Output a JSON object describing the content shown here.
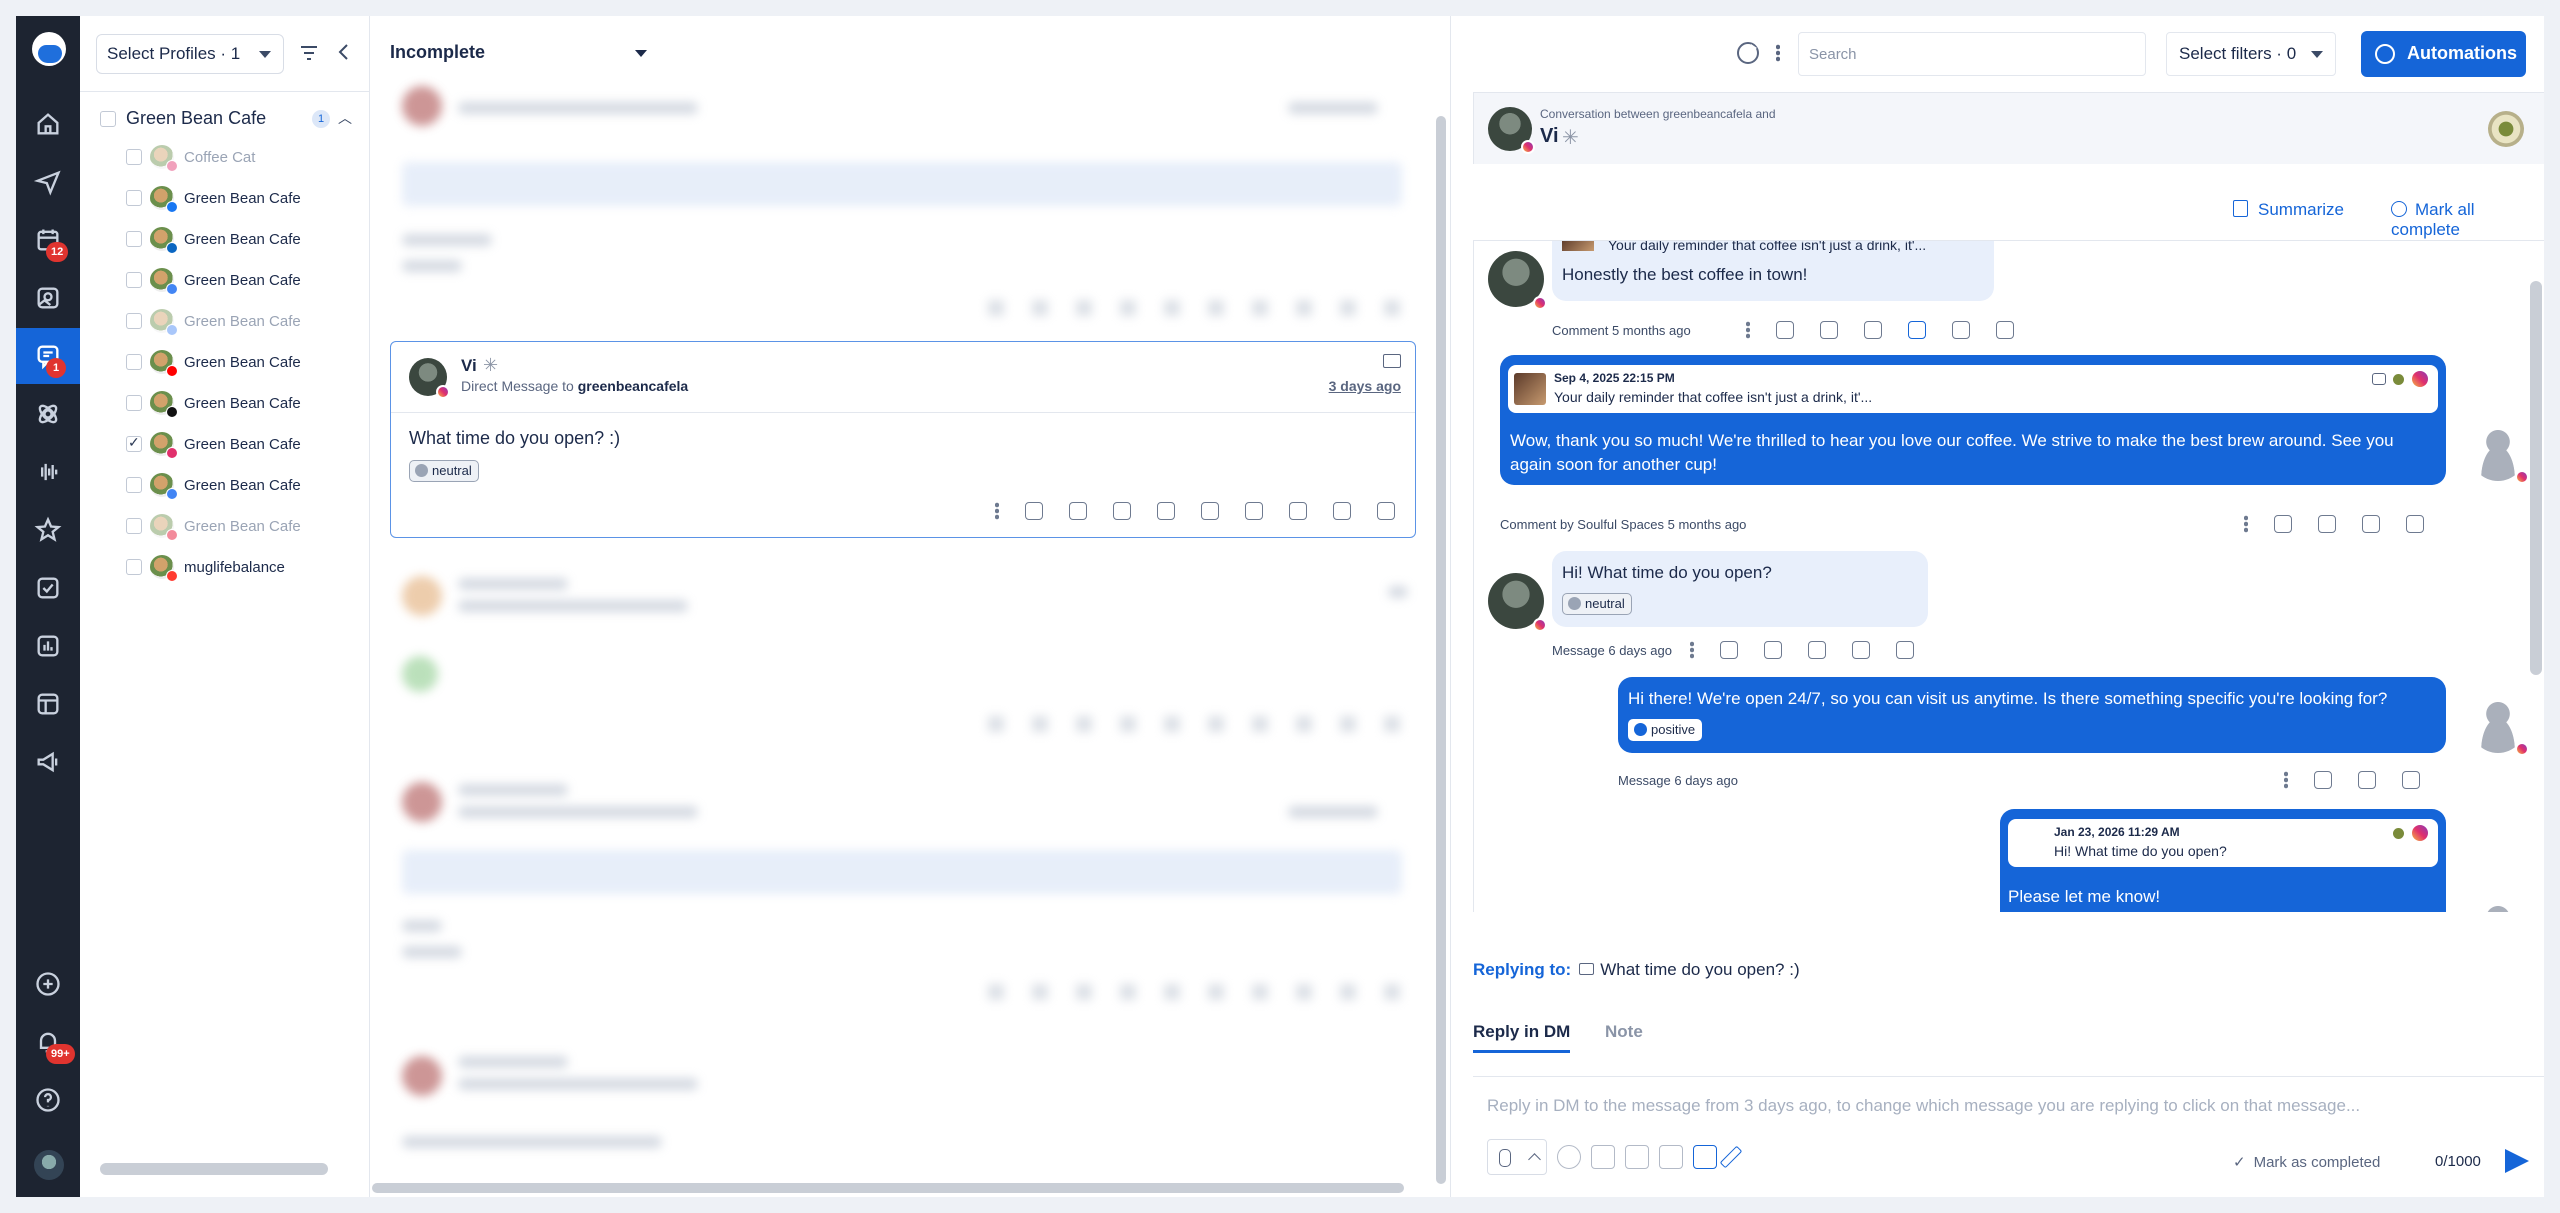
{
  "profiles_panel": {
    "select_profiles_label": "Select Profiles · 1",
    "group": {
      "name": "Green Bean Cafe",
      "count": "1"
    },
    "items": [
      {
        "name": "Coffee Cat",
        "dim": true,
        "checked": false,
        "network_color": "#e1306c"
      },
      {
        "name": "Green Bean Cafe",
        "dim": false,
        "checked": false,
        "network_color": "#1877f2"
      },
      {
        "name": "Green Bean Cafe",
        "dim": false,
        "checked": false,
        "network_color": "#0a66c2"
      },
      {
        "name": "Green Bean Cafe",
        "dim": false,
        "checked": false,
        "network_color": "#4285f4"
      },
      {
        "name": "Green Bean Cafe",
        "dim": true,
        "checked": false,
        "network_color": "#4285f4"
      },
      {
        "name": "Green Bean Cafe",
        "dim": false,
        "checked": false,
        "network_color": "#ff0000"
      },
      {
        "name": "Green Bean Cafe",
        "dim": false,
        "checked": false,
        "network_color": "#111111"
      },
      {
        "name": "Green Bean Cafe",
        "dim": false,
        "checked": true,
        "network_color": "#e1306c"
      },
      {
        "name": "Green Bean Cafe",
        "dim": false,
        "checked": false,
        "network_color": "#4285f4"
      },
      {
        "name": "Green Bean Cafe",
        "dim": true,
        "checked": false,
        "network_color": "#e60023"
      },
      {
        "name": "muglifebalance",
        "dim": false,
        "checked": false,
        "network_color": "#ff3b30"
      }
    ]
  },
  "rail": {
    "calendar_badge": "12",
    "inbox_badge": "1",
    "notifications_badge": "99+"
  },
  "middle": {
    "status_filter": "Incomplete",
    "selected_conversation": {
      "name": "Vi",
      "subtitle_prefix": "Direct Message to",
      "subtitle_account": "greenbeancafela",
      "time": "3 days ago",
      "text": "What time do you open? :)",
      "sentiment": "neutral"
    }
  },
  "toolbar": {
    "search_placeholder": "Search",
    "filters_label": "Select filters · 0",
    "automations_label": "Automations"
  },
  "chat": {
    "between": "Conversation between greenbeancafela and",
    "contact_name": "Vi",
    "summarize": "Summarize",
    "mark_all_complete": "Mark all complete",
    "messages": {
      "m1_quote": "Your daily reminder that coffee isn't just a drink, it'...",
      "m1_text": "Honestly the best coffee in town!",
      "m1_meta": "Comment 5 months ago",
      "m2_date": "Sep 4, 2025 22:15 PM",
      "m2_quote": "Your daily reminder that coffee isn't just a drink, it'...",
      "m2_text": "Wow, thank you so much! We're thrilled to hear you love our coffee. We strive to make the best brew around. See you again soon for another cup!",
      "m2_meta": "Comment by Soulful Spaces 5 months ago",
      "m3_text": "Hi! What time do you open?",
      "m3_sentiment": "neutral",
      "m3_meta": "Message 6 days ago",
      "m4_text": "Hi there! We're open 24/7, so you can visit us anytime. Is there something specific you're looking for?",
      "m4_sentiment": "positive",
      "m4_meta": "Message 6 days ago",
      "m5_date": "Jan 23, 2026 11:29 AM",
      "m5_quote": "Hi! What time do you open?",
      "m5_text": "Please let me know!"
    },
    "replying_label": "Replying to:",
    "replying_text": "What time do you open? :)",
    "tab_dm": "Reply in DM",
    "tab_note": "Note",
    "reply_placeholder": "Reply in DM to the message from 3 days ago, to change which message you are replying to click on that message...",
    "mark_completed": "Mark as completed",
    "counter": "0/1000"
  },
  "colors": {
    "accent": "#1565d8",
    "rail": "#1d2431",
    "bubble_in": "#e8effb"
  }
}
